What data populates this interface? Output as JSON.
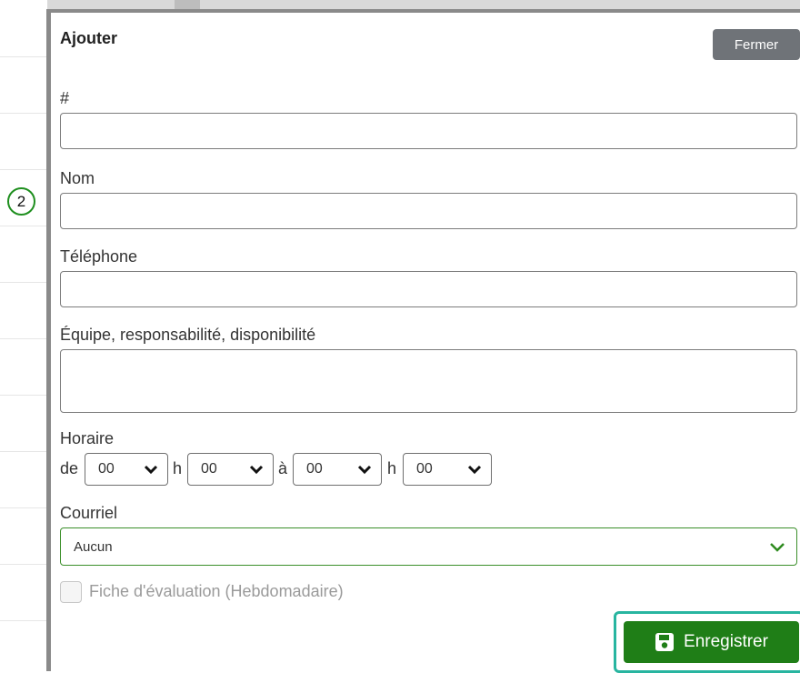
{
  "step_marker": "2",
  "modal": {
    "title": "Ajouter",
    "close_label": "Fermer"
  },
  "fields": {
    "number": {
      "label": "#",
      "value": ""
    },
    "name": {
      "label": "Nom",
      "value": ""
    },
    "phone": {
      "label": "Téléphone",
      "value": ""
    },
    "team": {
      "label": "Équipe, responsabilité, disponibilité",
      "value": ""
    }
  },
  "schedule": {
    "label": "Horaire",
    "from_word": "de",
    "hour_sep": "h",
    "to_word": "à",
    "from_hour": "00",
    "from_minute": "00",
    "to_hour": "00",
    "to_minute": "00"
  },
  "email": {
    "label": "Courriel",
    "selected": "Aucun"
  },
  "evaluation": {
    "label": "Fiche d'évaluation (Hebdomadaire)",
    "checked": false
  },
  "save_label": "Enregistrer",
  "colors": {
    "accent_green": "#1f7e17",
    "highlight_teal": "#28b5a0",
    "close_gray": "#6f7378"
  }
}
